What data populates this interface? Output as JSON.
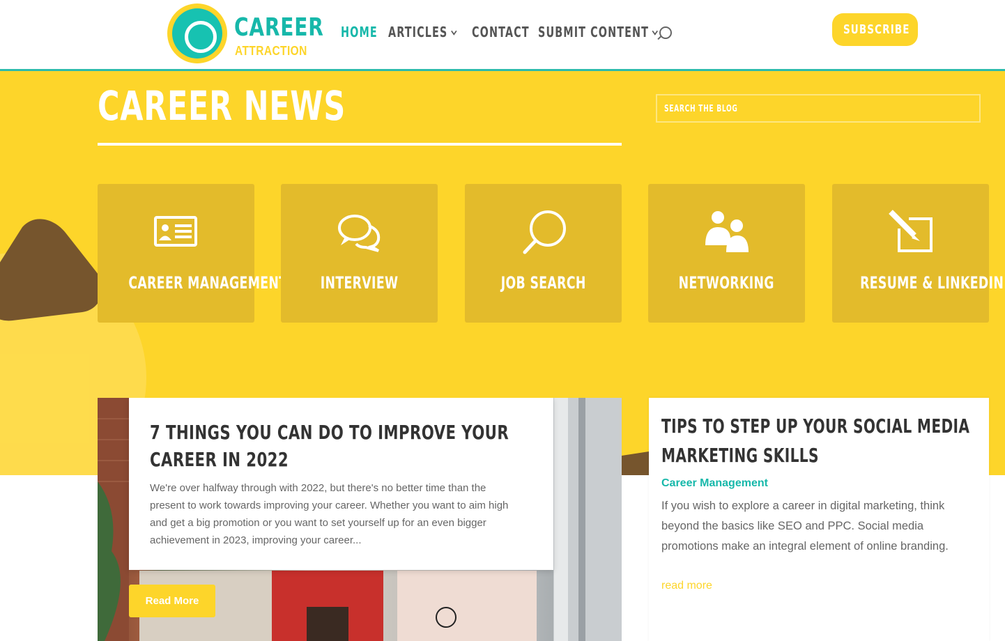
{
  "brand": {
    "name_top": "CAREER",
    "name_bottom": "ATTRACTION",
    "accent_teal": "#17b8aa",
    "accent_yellow": "#fdd52a",
    "brown": "#76552d"
  },
  "nav": {
    "items": [
      {
        "label": "HOME",
        "active": true,
        "has_dropdown": false
      },
      {
        "label": "ARTICLES",
        "active": false,
        "has_dropdown": true
      },
      {
        "label": "CONTACT",
        "active": false,
        "has_dropdown": false
      },
      {
        "label": "SUBMIT CONTENT",
        "active": false,
        "has_dropdown": true
      }
    ],
    "search_icon": "search-icon",
    "subscribe_label": "SUBSCRIBE"
  },
  "hero": {
    "title": "CAREER NEWS",
    "search_placeholder": "SEARCH THE BLOG"
  },
  "categories": [
    {
      "label": "CAREER MANAGEMENT",
      "icon": "id-card-icon"
    },
    {
      "label": "INTERVIEW",
      "icon": "chat-bubbles-icon"
    },
    {
      "label": "JOB SEARCH",
      "icon": "magnifier-icon"
    },
    {
      "label": "NETWORKING",
      "icon": "people-icon"
    },
    {
      "label": "RESUME & LINKEDIN",
      "icon": "edit-icon"
    }
  ],
  "featured_post": {
    "title": "7 THINGS YOU CAN DO TO IMPROVE YOUR CAREER IN 2022",
    "excerpt": "We're over halfway through with 2022, but there's no better time than the present to work towards improving your career. Whether you want to aim high and get a big promotion or you want to set yourself up for an even bigger achievement in 2023, improving your career...",
    "button_label": "Read More"
  },
  "side_post": {
    "title": "TIPS TO STEP UP YOUR SOCIAL MEDIA MARKETING SKILLS",
    "category": "Career Management",
    "excerpt": "If you wish to explore a career in digital marketing, think beyond the basics like SEO and PPC. Social media promotions make an integral element of online branding.",
    "more_label": "read more"
  }
}
